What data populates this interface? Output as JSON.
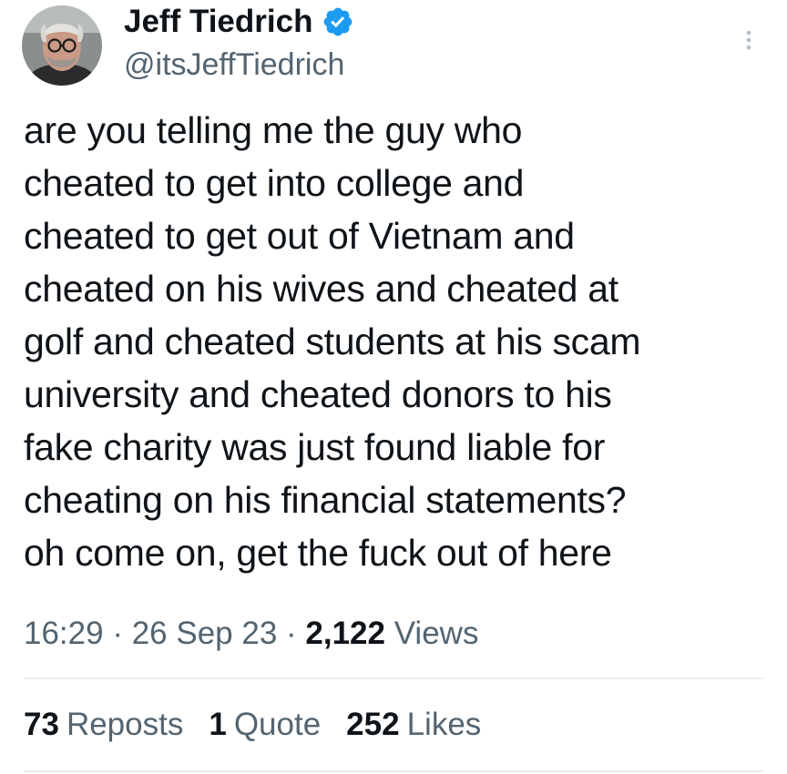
{
  "author": {
    "display_name": "Jeff Tiedrich",
    "handle": "@itsJeffTiedrich",
    "avatar_icon": "profile-photo",
    "verified_icon": "verified-badge-icon",
    "verified_color": "#1d9bf0"
  },
  "menu_icon": "more-vertical-icon",
  "tweet": {
    "lines": [
      "are you telling me the guy who",
      "cheated to get into college and",
      "cheated to get out of Vietnam and",
      "cheated on his wives and cheated at",
      "golf and cheated students at his scam",
      "university and cheated donors to his",
      "fake charity was just found liable for",
      "cheating on his financial statements?",
      "oh come on, get the fuck out of here"
    ]
  },
  "meta": {
    "time": "16:29",
    "sep1": " · ",
    "date": "26 Sep 23",
    "sep2": " · ",
    "views_count": "2,122",
    "views_label": " Views"
  },
  "stats": {
    "reposts": {
      "count": "73",
      "label": "Reposts"
    },
    "quotes": {
      "count": "1",
      "label": "Quote"
    },
    "likes": {
      "count": "252",
      "label": "Likes"
    }
  },
  "colors": {
    "text": "#0f1419",
    "secondary": "#536471",
    "divider": "#e6ecf0"
  }
}
